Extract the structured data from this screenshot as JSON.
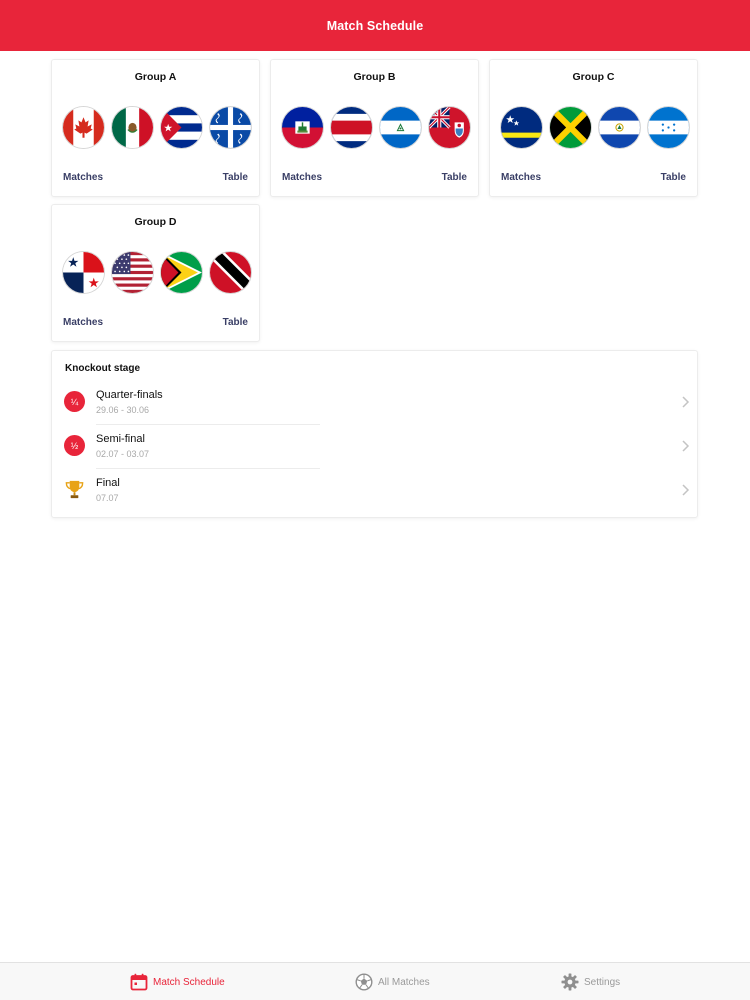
{
  "header": {
    "title": "Match Schedule"
  },
  "colors": {
    "accent": "#e8253a",
    "link": "#3a3f66",
    "muted": "#a8a8a8"
  },
  "groups": [
    {
      "title": "Group A",
      "flags": [
        "canada",
        "mexico",
        "cuba",
        "martinique"
      ],
      "matches_label": "Matches",
      "table_label": "Table"
    },
    {
      "title": "Group B",
      "flags": [
        "haiti",
        "costa-rica",
        "nicaragua",
        "bermuda"
      ],
      "matches_label": "Matches",
      "table_label": "Table"
    },
    {
      "title": "Group C",
      "flags": [
        "curacao",
        "jamaica",
        "el-salvador",
        "honduras"
      ],
      "matches_label": "Matches",
      "table_label": "Table"
    },
    {
      "title": "Group D",
      "flags": [
        "panama",
        "united-states",
        "guyana",
        "trinidad-and-tobago"
      ],
      "matches_label": "Matches",
      "table_label": "Table"
    }
  ],
  "knockout": {
    "title": "Knockout stage",
    "rows": [
      {
        "badge": "¼",
        "name": "Quarter-finals",
        "dates": "29.06 - 30.06",
        "icon": "badge"
      },
      {
        "badge": "½",
        "name": "Semi-final",
        "dates": "02.07 - 03.07",
        "icon": "badge"
      },
      {
        "badge": "",
        "name": "Final",
        "dates": "07.07",
        "icon": "trophy-icon"
      }
    ]
  },
  "tabs": [
    {
      "label": "Match Schedule",
      "icon": "calendar-icon",
      "active": true
    },
    {
      "label": "All Matches",
      "icon": "soccer-ball-icon",
      "active": false
    },
    {
      "label": "Settings",
      "icon": "gear-icon",
      "active": false
    }
  ]
}
